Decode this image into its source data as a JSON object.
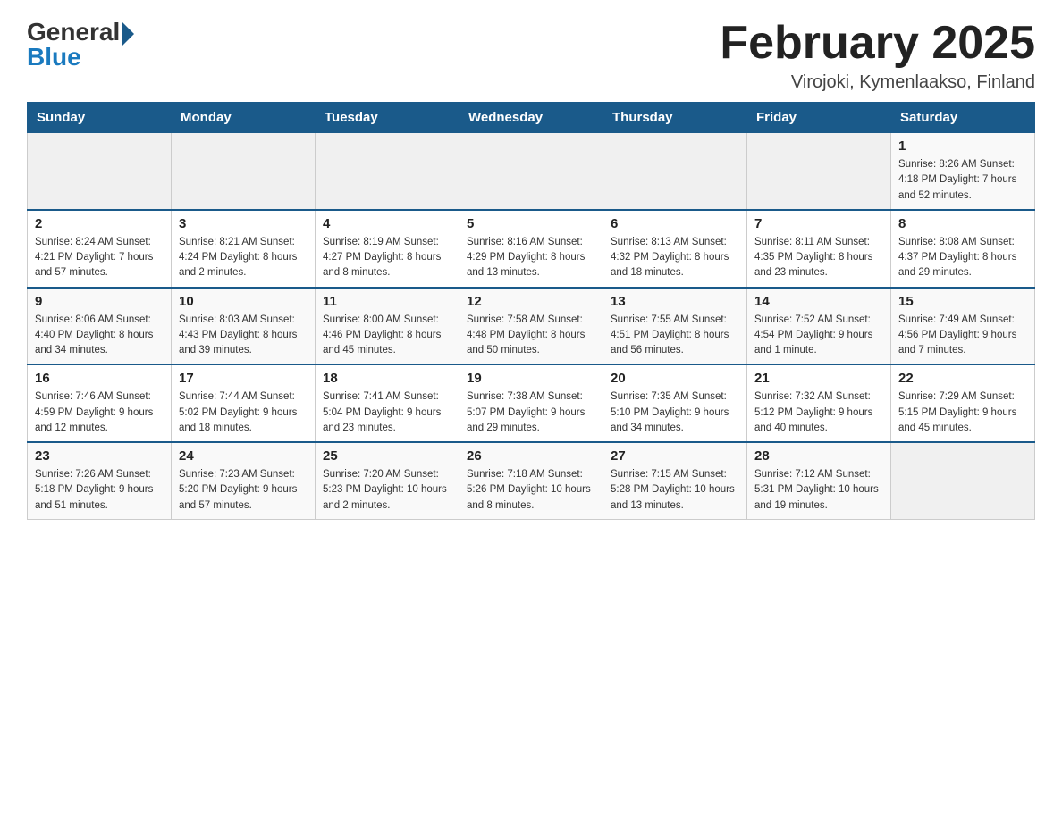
{
  "header": {
    "logo_general": "General",
    "logo_blue": "Blue",
    "month_title": "February 2025",
    "location": "Virojoki, Kymenlaakso, Finland"
  },
  "days_of_week": [
    "Sunday",
    "Monday",
    "Tuesday",
    "Wednesday",
    "Thursday",
    "Friday",
    "Saturday"
  ],
  "weeks": [
    [
      {
        "day": "",
        "info": ""
      },
      {
        "day": "",
        "info": ""
      },
      {
        "day": "",
        "info": ""
      },
      {
        "day": "",
        "info": ""
      },
      {
        "day": "",
        "info": ""
      },
      {
        "day": "",
        "info": ""
      },
      {
        "day": "1",
        "info": "Sunrise: 8:26 AM\nSunset: 4:18 PM\nDaylight: 7 hours\nand 52 minutes."
      }
    ],
    [
      {
        "day": "2",
        "info": "Sunrise: 8:24 AM\nSunset: 4:21 PM\nDaylight: 7 hours\nand 57 minutes."
      },
      {
        "day": "3",
        "info": "Sunrise: 8:21 AM\nSunset: 4:24 PM\nDaylight: 8 hours\nand 2 minutes."
      },
      {
        "day": "4",
        "info": "Sunrise: 8:19 AM\nSunset: 4:27 PM\nDaylight: 8 hours\nand 8 minutes."
      },
      {
        "day": "5",
        "info": "Sunrise: 8:16 AM\nSunset: 4:29 PM\nDaylight: 8 hours\nand 13 minutes."
      },
      {
        "day": "6",
        "info": "Sunrise: 8:13 AM\nSunset: 4:32 PM\nDaylight: 8 hours\nand 18 minutes."
      },
      {
        "day": "7",
        "info": "Sunrise: 8:11 AM\nSunset: 4:35 PM\nDaylight: 8 hours\nand 23 minutes."
      },
      {
        "day": "8",
        "info": "Sunrise: 8:08 AM\nSunset: 4:37 PM\nDaylight: 8 hours\nand 29 minutes."
      }
    ],
    [
      {
        "day": "9",
        "info": "Sunrise: 8:06 AM\nSunset: 4:40 PM\nDaylight: 8 hours\nand 34 minutes."
      },
      {
        "day": "10",
        "info": "Sunrise: 8:03 AM\nSunset: 4:43 PM\nDaylight: 8 hours\nand 39 minutes."
      },
      {
        "day": "11",
        "info": "Sunrise: 8:00 AM\nSunset: 4:46 PM\nDaylight: 8 hours\nand 45 minutes."
      },
      {
        "day": "12",
        "info": "Sunrise: 7:58 AM\nSunset: 4:48 PM\nDaylight: 8 hours\nand 50 minutes."
      },
      {
        "day": "13",
        "info": "Sunrise: 7:55 AM\nSunset: 4:51 PM\nDaylight: 8 hours\nand 56 minutes."
      },
      {
        "day": "14",
        "info": "Sunrise: 7:52 AM\nSunset: 4:54 PM\nDaylight: 9 hours\nand 1 minute."
      },
      {
        "day": "15",
        "info": "Sunrise: 7:49 AM\nSunset: 4:56 PM\nDaylight: 9 hours\nand 7 minutes."
      }
    ],
    [
      {
        "day": "16",
        "info": "Sunrise: 7:46 AM\nSunset: 4:59 PM\nDaylight: 9 hours\nand 12 minutes."
      },
      {
        "day": "17",
        "info": "Sunrise: 7:44 AM\nSunset: 5:02 PM\nDaylight: 9 hours\nand 18 minutes."
      },
      {
        "day": "18",
        "info": "Sunrise: 7:41 AM\nSunset: 5:04 PM\nDaylight: 9 hours\nand 23 minutes."
      },
      {
        "day": "19",
        "info": "Sunrise: 7:38 AM\nSunset: 5:07 PM\nDaylight: 9 hours\nand 29 minutes."
      },
      {
        "day": "20",
        "info": "Sunrise: 7:35 AM\nSunset: 5:10 PM\nDaylight: 9 hours\nand 34 minutes."
      },
      {
        "day": "21",
        "info": "Sunrise: 7:32 AM\nSunset: 5:12 PM\nDaylight: 9 hours\nand 40 minutes."
      },
      {
        "day": "22",
        "info": "Sunrise: 7:29 AM\nSunset: 5:15 PM\nDaylight: 9 hours\nand 45 minutes."
      }
    ],
    [
      {
        "day": "23",
        "info": "Sunrise: 7:26 AM\nSunset: 5:18 PM\nDaylight: 9 hours\nand 51 minutes."
      },
      {
        "day": "24",
        "info": "Sunrise: 7:23 AM\nSunset: 5:20 PM\nDaylight: 9 hours\nand 57 minutes."
      },
      {
        "day": "25",
        "info": "Sunrise: 7:20 AM\nSunset: 5:23 PM\nDaylight: 10 hours\nand 2 minutes."
      },
      {
        "day": "26",
        "info": "Sunrise: 7:18 AM\nSunset: 5:26 PM\nDaylight: 10 hours\nand 8 minutes."
      },
      {
        "day": "27",
        "info": "Sunrise: 7:15 AM\nSunset: 5:28 PM\nDaylight: 10 hours\nand 13 minutes."
      },
      {
        "day": "28",
        "info": "Sunrise: 7:12 AM\nSunset: 5:31 PM\nDaylight: 10 hours\nand 19 minutes."
      },
      {
        "day": "",
        "info": ""
      }
    ]
  ]
}
